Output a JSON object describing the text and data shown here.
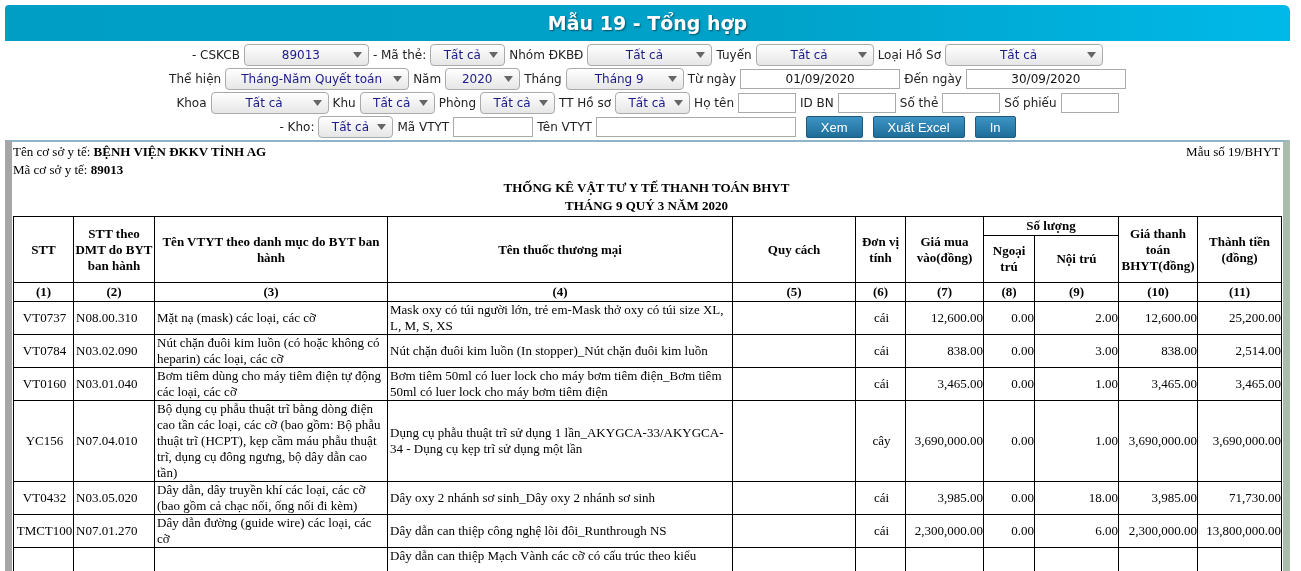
{
  "header": {
    "title": "Mẫu 19 - Tổng hợp"
  },
  "filters": [
    [
      {
        "kind": "select",
        "label": "- CSKCB",
        "value": "89013"
      },
      {
        "kind": "select",
        "label": "- Mã thẻ:",
        "value": "Tất cả"
      },
      {
        "kind": "select",
        "label": "Nhóm ĐKBĐ",
        "value": "Tất cả"
      },
      {
        "kind": "select",
        "label": "Tuyến",
        "value": "Tất cả"
      },
      {
        "kind": "select",
        "label": "Loại Hồ Sơ",
        "value": "Tất cả"
      }
    ],
    [
      {
        "kind": "select",
        "label": "Thể hiện",
        "value": "Tháng-Năm Quyết toán"
      },
      {
        "kind": "select",
        "label": "Năm",
        "value": "2020"
      },
      {
        "kind": "select",
        "label": "Tháng",
        "value": "Tháng 9"
      },
      {
        "kind": "input",
        "label": "Từ ngày",
        "value": "01/09/2020"
      },
      {
        "kind": "input",
        "label": "Đến ngày",
        "value": "30/09/2020"
      }
    ],
    [
      {
        "kind": "select",
        "label": "Khoa",
        "value": "Tất cả"
      },
      {
        "kind": "select",
        "label": "Khu",
        "value": "Tất cả"
      },
      {
        "kind": "select",
        "label": "Phòng",
        "value": "Tất cả"
      },
      {
        "kind": "select",
        "label": "TT Hồ sơ",
        "value": "Tất cả"
      },
      {
        "kind": "input",
        "label": "Họ tên"
      },
      {
        "kind": "input",
        "label": "ID BN"
      },
      {
        "kind": "input",
        "label": "Số thẻ"
      },
      {
        "kind": "input",
        "label": "Số phiếu"
      }
    ],
    [
      {
        "kind": "select",
        "label": "- Kho:",
        "value": "Tất cả"
      },
      {
        "kind": "input",
        "label": "Mã VTYT"
      },
      {
        "kind": "input",
        "label": "Tên VTYT"
      },
      {
        "kind": "button",
        "label": "Xem"
      },
      {
        "kind": "button",
        "label": "Xuất Excel"
      },
      {
        "kind": "button",
        "label": "In"
      }
    ]
  ],
  "report": {
    "facility_name": "Tên cơ sở y tế: **BỆNH VIỆN ĐKKV TỈNH AG**",
    "facility_code": "Mã cơ sở y tế: **89013**",
    "form_number": "Mẫu số 19/BHYT",
    "title": "THỐNG KÊ VẬT TƯ Y TẾ THANH TOÁN BHYT",
    "subtitle": "THÁNG 9 QUÝ 3 NĂM 2020"
  },
  "table": {
    "columns": [
      {
        "heading": "STT",
        "number": "(1)"
      },
      {
        "heading": "STT theo DMT do BYT ban hành",
        "number": "(2)"
      },
      {
        "heading": "Tên VTYT theo danh mục do BYT ban hành",
        "number": "(3)"
      },
      {
        "heading": "Tên thuốc thương mại",
        "number": "(4)"
      },
      {
        "heading": "Quy cách",
        "number": "(5)"
      },
      {
        "heading": "Đơn vị tính",
        "number": "(6)"
      },
      {
        "heading": "Giá mua vào(đồng)",
        "number": "(7)"
      },
      {
        "heading": "Số lượng",
        "colspan": 2,
        "children": [
          {
            "heading": "Ngoại trú",
            "number": "(8)"
          },
          {
            "heading": "Nội trú",
            "number": "(9)"
          }
        ]
      },
      {
        "heading": "Giá thanh toán BHYT(đồng)",
        "number": "(10)"
      },
      {
        "heading": "Thành tiền (đồng)",
        "number": "(11)"
      }
    ],
    "rows": [
      {
        "cells": [
          "VT0737",
          "N08.00.310",
          "Mặt nạ (mask) các loại, các cỡ",
          "Mask oxy có túi người lớn, trẻ em-Mask thở oxy có túi size XL, L, M, S, XS",
          null,
          "cái",
          "12,600.00",
          "0.00",
          "2.00",
          "12,600.00",
          "25,200.00"
        ]
      },
      {
        "cells": [
          "VT0784",
          "N03.02.090",
          "Nút chặn đuôi kim luồn (có hoặc không có heparin) các loại, các cỡ",
          "Nút chặn đuôi kim luồn (In stopper)_Nút chặn đuôi kim luồn",
          null,
          "cái",
          "838.00",
          "0.00",
          "3.00",
          "838.00",
          "2,514.00"
        ]
      },
      {
        "cells": [
          "VT0160",
          "N03.01.040",
          "Bơm tiêm dùng cho máy tiêm điện tự động các loại, các cỡ",
          "Bơm tiêm 50ml có luer lock cho máy bơm tiêm điện_Bơm tiêm 50ml có luer lock cho máy bơm tiêm điện",
          null,
          "cái",
          "3,465.00",
          "0.00",
          "1.00",
          "3,465.00",
          "3,465.00"
        ]
      },
      {
        "cells": [
          "YC156",
          "N07.04.010",
          "Bộ dụng cụ phẫu thuật trĩ bằng dòng điện cao tần các loại, các cỡ (bao gồm: Bộ phẫu thuật trĩ (HCPT), kẹp cầm máu phẫu thuật trĩ, dụng cụ đông ngưng, bộ dây dẫn cao tần)",
          "Dụng cụ phẫu thuật trĩ sử dụng 1 lần_AKYGCA-33/AKYGCA-34 - Dụng cụ kẹp trĩ sử dụng một lần",
          null,
          "cây",
          "3,690,000.00",
          "0.00",
          "1.00",
          "3,690,000.00",
          "3,690,000.00"
        ]
      },
      {
        "cells": [
          "VT0432",
          "N03.05.020",
          "Dây dẫn, dây truyền khí các loại, các cỡ (bao gồm cả chạc nối, ống nối đi kèm)",
          "Dây oxy 2 nhánh sơ sinh_Dây oxy 2 nhánh sơ sinh",
          null,
          "cái",
          "3,985.00",
          "0.00",
          "18.00",
          "3,985.00",
          "71,730.00"
        ]
      },
      {
        "cells": [
          "TMCT100",
          "N07.01.270",
          "Dây dẫn đường (guide wire) các loại, các cỡ",
          "Dây dẫn can thiệp công nghệ lõi đôi_Runthrough NS",
          null,
          "cái",
          "2,300,000.00",
          "0.00",
          "6.00",
          "2,300,000.00",
          "13,800,000.00"
        ]
      },
      {
        "cells": [
          null,
          null,
          null,
          "Dây dẫn can thiệp Mạch Vành các cỡ có cấu trúc theo kiểu",
          null,
          null,
          null,
          null,
          null,
          null,
          null
        ]
      }
    ]
  }
}
